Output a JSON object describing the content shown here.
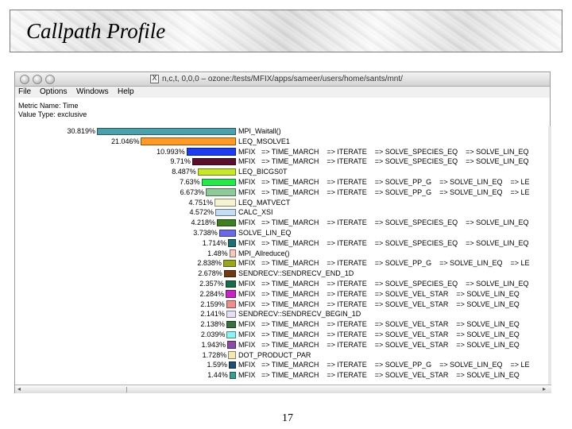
{
  "slide": {
    "title": "Callpath Profile",
    "page_number": "17"
  },
  "window": {
    "title": "n,c,t, 0,0,0 – ozone:/tests/MFIX/apps/sameer/users/home/sants/mnt/"
  },
  "menu": [
    "File",
    "Options",
    "Windows",
    "Help"
  ],
  "info": {
    "metric": "Metric Name: Time",
    "value_type": "Value Type: exclusive"
  },
  "rows": [
    {
      "pct": "30.819%",
      "value": 30.819,
      "color": "#4aa1ac",
      "label": "MPI_Waitall()"
    },
    {
      "pct": "21.046%",
      "value": 21.046,
      "color": "#ff9a26",
      "label": "LEQ_MSOLVE1"
    },
    {
      "pct": "10.993%",
      "value": 10.993,
      "color": "#1c3cf0",
      "label": "MFIX   => TIME_MARCH    => ITERATE    => SOLVE_SPECIES_EQ    => SOLVE_LIN_EQ"
    },
    {
      "pct": "9.71%",
      "value": 9.71,
      "color": "#5a0f2e",
      "label": "MFIX   => TIME_MARCH    => ITERATE    => SOLVE_SPECIES_EQ    => SOLVE_LIN_EQ"
    },
    {
      "pct": "8.487%",
      "value": 8.487,
      "color": "#c8e62c",
      "label": "LEQ_BICGS0T"
    },
    {
      "pct": "7.63%",
      "value": 7.63,
      "color": "#26e84a",
      "label": "MFIX   => TIME_MARCH    => ITERATE    => SOLVE_PP_G    => SOLVE_LIN_EQ    => LE"
    },
    {
      "pct": "6.673%",
      "value": 6.673,
      "color": "#8ec99a",
      "label": "MFIX   => TIME_MARCH    => ITERATE    => SOLVE_PP_G    => SOLVE_LIN_EQ    => LE"
    },
    {
      "pct": "4.751%",
      "value": 4.751,
      "color": "#f4f4d2",
      "label": "LEQ_MATVECT"
    },
    {
      "pct": "4.572%",
      "value": 4.572,
      "color": "#c4dcf4",
      "label": "CALC_XSI"
    },
    {
      "pct": "4.218%",
      "value": 4.218,
      "color": "#3e7e20",
      "label": "MFIX   => TIME_MARCH    => ITERATE    => SOLVE_SPECIES_EQ    => SOLVE_LIN_EQ"
    },
    {
      "pct": "3.738%",
      "value": 3.738,
      "color": "#6a6ae6",
      "label": "SOLVE_LIN_EQ"
    },
    {
      "pct": "1.714%",
      "value": 1.714,
      "color": "#1e6e76",
      "label": "MFIX   => TIME_MARCH    => ITERATE    => SOLVE_SPECIES_EQ    => SOLVE_LIN_EQ"
    },
    {
      "pct": "1.48%",
      "value": 1.48,
      "color": "#f6c8c0",
      "label": "MPI_Allreduce()"
    },
    {
      "pct": "2.838%",
      "value": 2.838,
      "color": "#9aa41e",
      "label": "MFIX   => TIME_MARCH    => ITERATE    => SOLVE_PP_G    => SOLVE_LIN_EQ    => LE"
    },
    {
      "pct": "2.678%",
      "value": 2.678,
      "color": "#6e3a14",
      "label": "SENDRECV::SENDRECV_END_1D"
    },
    {
      "pct": "2.357%",
      "value": 2.357,
      "color": "#1a6a4a",
      "label": "MFIX   => TIME_MARCH    => ITERATE    => SOLVE_SPECIES_EQ    => SOLVE_LIN_EQ"
    },
    {
      "pct": "2.284%",
      "value": 2.284,
      "color": "#c226c2",
      "label": "MFIX   => TIME_MARCH    => ITERATE    => SOLVE_VEL_STAR    => SOLVE_LIN_EQ"
    },
    {
      "pct": "2.159%",
      "value": 2.159,
      "color": "#ee8e8e",
      "label": "MFIX   => TIME_MARCH    => ITERATE    => SOLVE_VEL_STAR    => SOLVE_LIN_EQ"
    },
    {
      "pct": "2.141%",
      "value": 2.141,
      "color": "#e6e0f4",
      "label": "SENDRECV::SENDRECV_BEGIN_1D"
    },
    {
      "pct": "2.138%",
      "value": 2.138,
      "color": "#3a6e3e",
      "label": "MFIX   => TIME_MARCH    => ITERATE    => SOLVE_VEL_STAR    => SOLVE_LIN_EQ"
    },
    {
      "pct": "2.039%",
      "value": 2.039,
      "color": "#8af4f4",
      "label": "MFIX   => TIME_MARCH    => ITERATE    => SOLVE_VEL_STAR    => SOLVE_LIN_EQ"
    },
    {
      "pct": "1.943%",
      "value": 1.943,
      "color": "#8a4aa6",
      "label": "MFIX   => TIME_MARCH    => ITERATE    => SOLVE_VEL_STAR    => SOLVE_LIN_EQ"
    },
    {
      "pct": "1.728%",
      "value": 1.728,
      "color": "#f6e6b4",
      "label": "DOT_PRODUCT_PAR"
    },
    {
      "pct": "1.59%",
      "value": 1.59,
      "color": "#204e6e",
      "label": "MFIX   => TIME_MARCH    => ITERATE    => SOLVE_PP_G    => SOLVE_LIN_EQ    => LE"
    },
    {
      "pct": "1.44%",
      "value": 1.44,
      "color": "#3a9e8e",
      "label": "MFIX   => TIME_MARCH    => ITERATE    => SOLVE_VEL_STAR    => SOLVE_LIN_EQ"
    }
  ]
}
